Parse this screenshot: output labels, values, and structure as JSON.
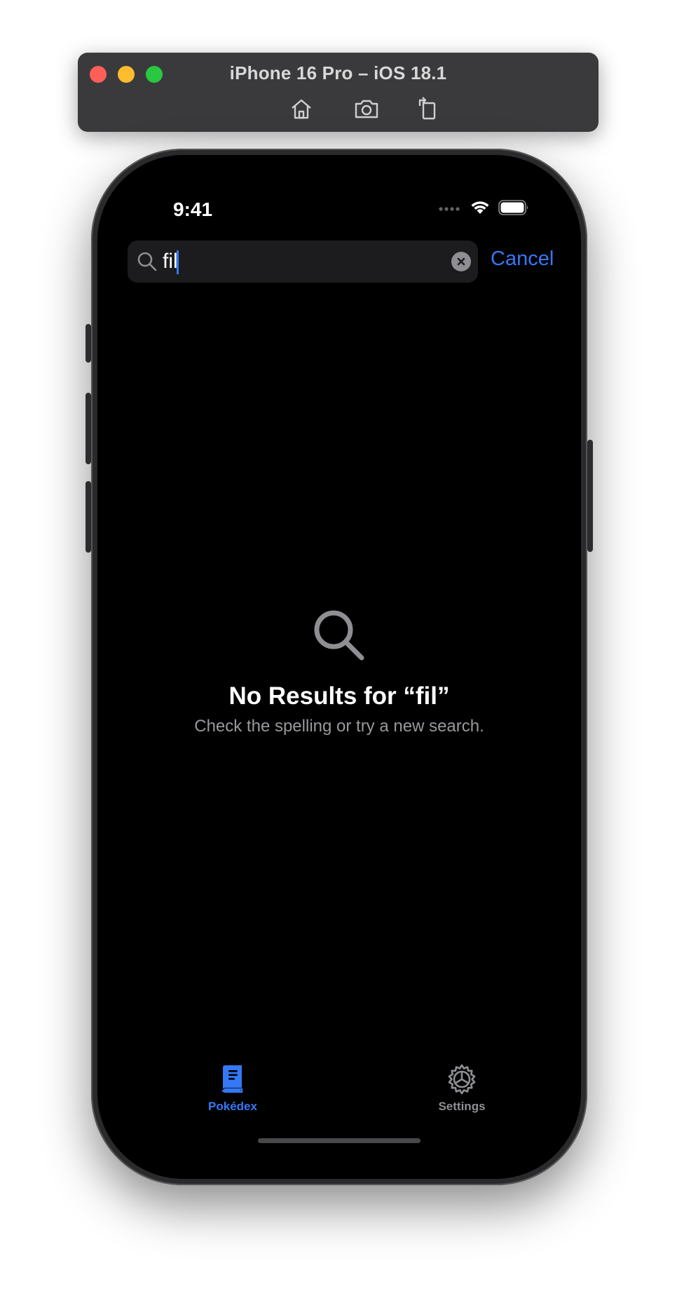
{
  "simulator": {
    "title": "iPhone 16 Pro – iOS 18.1",
    "tools": [
      "home-icon",
      "screenshot-icon",
      "rotate-icon"
    ]
  },
  "status_bar": {
    "time": "9:41"
  },
  "search": {
    "value": "fil",
    "cancel_label": "Cancel"
  },
  "empty_state": {
    "title": "No Results for “fil”",
    "subtitle": "Check the spelling or try a new search."
  },
  "tab_bar": {
    "items": [
      {
        "label": "Pokédex",
        "icon": "book-icon",
        "active": true
      },
      {
        "label": "Settings",
        "icon": "gear-icon",
        "active": false
      }
    ]
  },
  "colors": {
    "accent": "#3478f6",
    "screen_bg": "#000000",
    "secondary_text": "#98989d",
    "inactive_tab": "#8e8e93"
  }
}
